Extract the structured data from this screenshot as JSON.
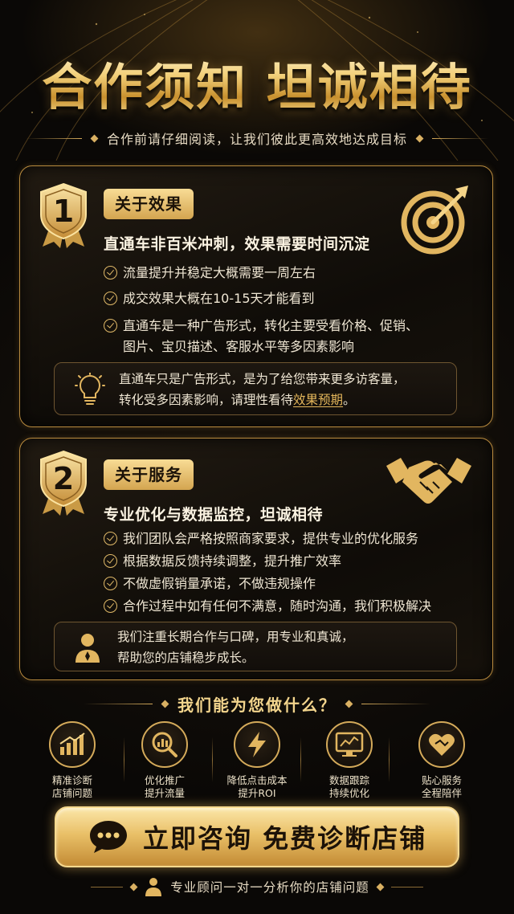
{
  "header": {
    "title": "合作须知 坦诚相待",
    "subtitle": "合作前请仔细阅读，让我们彼此更高效地达成目标"
  },
  "section1": {
    "number": "1",
    "tag": "关于效果",
    "heading": "直通车非百米冲刺，效果需要时间沉淀",
    "items": [
      "流量提升并稳定大概需要一周左右",
      "成交效果大概在10-15天才能看到",
      "直通车是一种广告形式，转化主要受看价格、促销、",
      "图片、宝贝描述、客服水平等多因素影响"
    ],
    "note_line1": "直通车只是广告形式，是为了给您带来更多访客量，",
    "note_line2_prefix": "转化受多因素影响，请理性看待",
    "note_highlight1": "效果",
    "note_highlight2": "预期",
    "note_suffix": "。",
    "icon": "target-arrow-icon"
  },
  "section2": {
    "number": "2",
    "tag": "关于服务",
    "heading": "专业优化与数据监控，坦诚相待",
    "items": [
      "我们团队会严格按照商家要求，提供专业的优化服务",
      "根据数据反馈持续调整，提升推广效率",
      "不做虚假销量承诺，不做违规操作",
      "合作过程中如有任何不满意，随时沟通，我们积极解决"
    ],
    "note_line1": "我们注重长期合作与口碑，用专业和真诚，",
    "note_line2": "帮助您的店铺稳步成长。",
    "icon": "handshake-icon"
  },
  "services": {
    "title": "我们能为您做什么？",
    "items": [
      {
        "label": "精准诊断\n店铺问题",
        "icon": "bar-chart-icon"
      },
      {
        "label": "优化推广\n提升流量",
        "icon": "magnifier-chart-icon"
      },
      {
        "label": "降低点击成本\n提升ROI",
        "icon": "lightning-icon"
      },
      {
        "label": "数据跟踪\n持续优化",
        "icon": "monitor-chart-icon"
      },
      {
        "label": "贴心服务\n全程陪伴",
        "icon": "heart-handshake-icon"
      }
    ]
  },
  "cta": {
    "label": "立即咨询 免费诊断店铺"
  },
  "footer": {
    "text": "专业顾问一对一分析你的店铺问题"
  },
  "colors": {
    "gold": "#d4aa5a",
    "gold_light": "#f8dc95",
    "background": "#0b0907"
  }
}
